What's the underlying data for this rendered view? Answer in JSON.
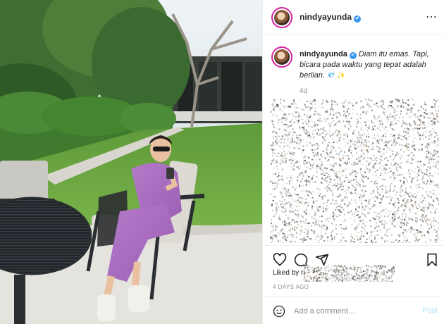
{
  "post": {
    "username": "nindyayunda",
    "verified_icon": "verified-badge-icon",
    "more_icon": "more-options-icon",
    "caption_body": "Diam itu emas. Tapi, bicara pada waktu yang tepat adalah berlian.",
    "caption_emoji_1": "💎",
    "caption_emoji_2": "✨",
    "caption_age": "4d",
    "likes_prefix": "Liked by ",
    "likes_visible_fragment": "ri",
    "date": "4 DAYS AGO",
    "comment_placeholder": "Add a comment...",
    "post_label": "Post",
    "accent_color": "#3897f0",
    "post_disabled_color": "#b2dffc"
  },
  "icons": {
    "like": "heart-icon",
    "comment": "comment-icon",
    "share": "share-icon",
    "save": "bookmark-icon",
    "emoji": "emoji-icon"
  }
}
